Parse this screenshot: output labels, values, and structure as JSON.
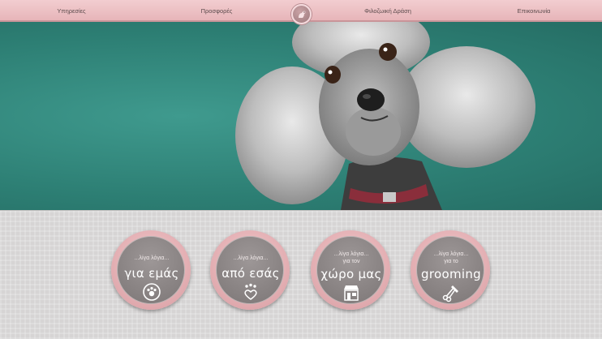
{
  "nav": {
    "items": [
      {
        "label": "Υπηρεσίες"
      },
      {
        "label": "Προσφορές"
      },
      {
        "label": "Φιλοζωική Δράση"
      },
      {
        "label": "Επικοινωνία"
      }
    ]
  },
  "badges": [
    {
      "small_line1": "...λίγα λόγια...",
      "small_line2": "",
      "big": "για εμάς",
      "icon": "paw-circle-icon"
    },
    {
      "small_line1": "...λίγα λόγια...",
      "small_line2": "",
      "big": "από εσάς",
      "icon": "paw-heart-icon"
    },
    {
      "small_line1": "...λίγα λόγια...",
      "small_line2": "για τον",
      "big": "χώρο μας",
      "icon": "shop-icon"
    },
    {
      "small_line1": "...λίγα λόγια...",
      "small_line2": "για το",
      "big": "grooming",
      "icon": "scissors-comb-icon"
    }
  ],
  "colors": {
    "nav_pink": "#e7b5b9",
    "hero_teal": "#2d7f74",
    "badge_ring": "#d89da2",
    "badge_inner": "#8a8484"
  }
}
